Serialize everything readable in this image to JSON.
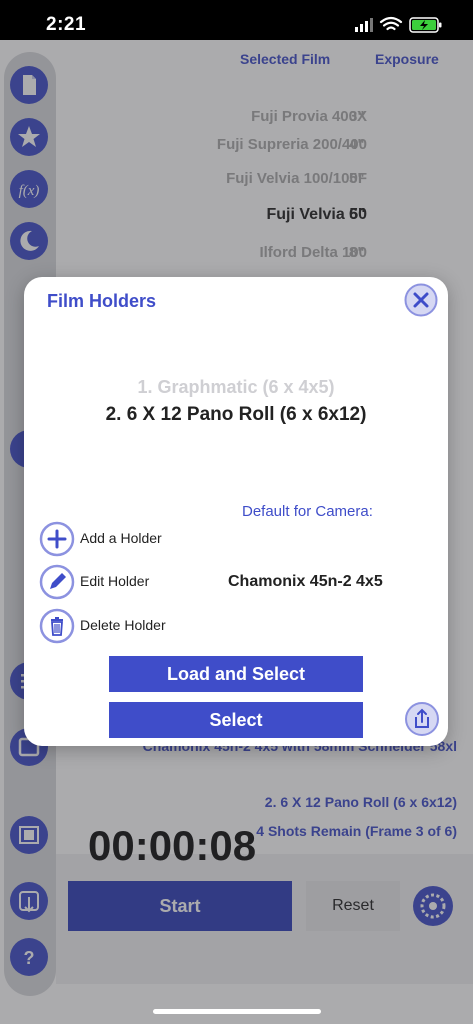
{
  "status_bar": {
    "time": "2:21"
  },
  "film_list": {
    "header_film": "Selected Film",
    "header_exposure": "Exposure",
    "rows": [
      {
        "name": "Fuji Provia 400X",
        "exposure": "3\"",
        "selected": false
      },
      {
        "name": "Fuji Supreria 200/400",
        "exposure": "4\"",
        "selected": false
      },
      {
        "name": "Fuji Velvia 100/100F",
        "exposure": "5\"",
        "selected": false
      },
      {
        "name": "Fuji Velvia 50",
        "exposure": "6\"",
        "selected": true
      },
      {
        "name": "Ilford Delta 100",
        "exposure": "8\"",
        "selected": false
      }
    ]
  },
  "background_info": {
    "lens_line": "Chamonix 45n-2 4x5 with 58mm Schneider 58xl",
    "holder_line": "2. 6 X 12 Pano Roll (6 x 6x12)",
    "shots_line": "4 Shots Remain (Frame 3 of 6)"
  },
  "timer": {
    "display": "00:00:08",
    "start_label": "Start",
    "reset_label": "Reset"
  },
  "modal": {
    "title": "Film Holders",
    "picker_dim": "1. Graphmatic (6 x 4x5)",
    "picker_selected": "2. 6 X 12 Pano Roll (6 x 6x12)",
    "default_label": "Default for Camera:",
    "camera_name": "Chamonix 45n-2 4x5",
    "actions": {
      "add": "Add a Holder",
      "edit": "Edit Holder",
      "delete": "Delete Holder"
    },
    "load_select_label": "Load and Select",
    "select_label": "Select"
  },
  "colors": {
    "accent": "#3f4dc9",
    "accent_light": "#8c92e0"
  }
}
